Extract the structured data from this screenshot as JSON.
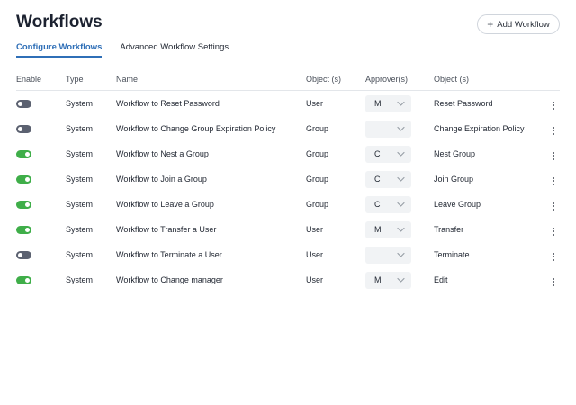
{
  "header": {
    "title": "Workflows",
    "add_button_label": "Add Workflow",
    "add_button_icon": "plus-icon"
  },
  "tabs": [
    {
      "label": "Configure Workflows",
      "active": true
    },
    {
      "label": "Advanced Workflow Settings",
      "active": false
    }
  ],
  "table": {
    "columns": [
      "Enable",
      "Type",
      "Name",
      "Object (s)",
      "Approver(s)",
      "Object (s)"
    ],
    "rows": [
      {
        "enabled": false,
        "type": "System",
        "name": "Workflow to Reset Password",
        "object": "User",
        "approver": "M",
        "object2": "Reset Password"
      },
      {
        "enabled": false,
        "type": "System",
        "name": "Workflow to Change Group Expiration Policy",
        "object": "Group",
        "approver": "",
        "object2": "Change Expiration Policy"
      },
      {
        "enabled": true,
        "type": "System",
        "name": "Workflow to Nest a Group",
        "object": "Group",
        "approver": "C",
        "object2": "Nest Group"
      },
      {
        "enabled": true,
        "type": "System",
        "name": "Workflow to Join a Group",
        "object": "Group",
        "approver": "C",
        "object2": "Join Group"
      },
      {
        "enabled": true,
        "type": "System",
        "name": "Workflow to Leave a Group",
        "object": "Group",
        "approver": "C",
        "object2": "Leave Group"
      },
      {
        "enabled": true,
        "type": "System",
        "name": "Workflow to Transfer a User",
        "object": "User",
        "approver": "M",
        "object2": "Transfer"
      },
      {
        "enabled": false,
        "type": "System",
        "name": "Workflow to Terminate a User",
        "object": "User",
        "approver": "",
        "object2": "Terminate"
      },
      {
        "enabled": true,
        "type": "System",
        "name": "Workflow to Change manager",
        "object": "User",
        "approver": "M",
        "object2": "Edit"
      }
    ]
  },
  "colors": {
    "accent": "#2f6fb7",
    "toggle_on": "#3fae49",
    "toggle_off": "#5b6170"
  }
}
